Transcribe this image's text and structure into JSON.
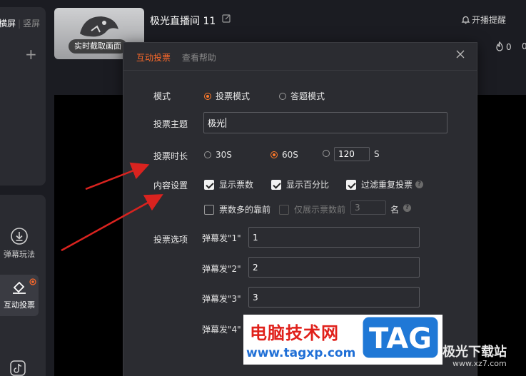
{
  "sidebar": {
    "tabs": {
      "landscape": "横屏",
      "portrait": "竖屏"
    },
    "add_icon": "plus-icon",
    "tools": [
      {
        "label": "弹幕玩法",
        "icon": "download-icon"
      },
      {
        "label": "互动投票",
        "icon": "vote-icon"
      }
    ]
  },
  "header": {
    "capture_button": "实时截取画面",
    "room_title": "极光直播间 11",
    "remind": "开播提醒",
    "hot_count": "0",
    "hot_count_2": "0"
  },
  "dialog": {
    "tabs": [
      "互动投票",
      "查看帮助"
    ],
    "mode": {
      "label": "模式",
      "options": [
        {
          "label": "投票模式",
          "selected": true
        },
        {
          "label": "答题模式",
          "selected": false
        }
      ]
    },
    "topic": {
      "label": "投票主题",
      "value": "极光"
    },
    "duration": {
      "label": "投票时长",
      "options": [
        {
          "label": "30S",
          "selected": false
        },
        {
          "label": "60S",
          "selected": true
        },
        {
          "label": "",
          "selected": false
        }
      ],
      "custom_value": "120",
      "unit": "S"
    },
    "content": {
      "label": "内容设置",
      "checks": [
        {
          "label": "显示票数",
          "checked": true
        },
        {
          "label": "显示百分比",
          "checked": true
        },
        {
          "label": "过滤重复投票",
          "checked": true
        },
        {
          "label": "票数多的靠前",
          "checked": false
        },
        {
          "label": "仅展示票数前",
          "checked": false
        }
      ],
      "top_n_value": "3",
      "top_n_unit": "名",
      "help_glyph": "?"
    },
    "options": {
      "label": "投票选项",
      "items": [
        {
          "key": "弹幕发\"1\"",
          "value": "1"
        },
        {
          "key": "弹幕发\"2\"",
          "value": "2"
        },
        {
          "key": "弹幕发\"3\"",
          "value": "3"
        },
        {
          "key": "弹幕发\"4\"",
          "value": ""
        }
      ]
    }
  },
  "watermark": {
    "cn_text": "电脑技术网",
    "url": "www.tagxp.com",
    "tag_text": "TAG",
    "site": "极光下载站",
    "site_url": "www.xz7.com"
  },
  "colors": {
    "accent": "#ff6a2a",
    "arrow": "#d9231f",
    "tag_blue": "#1f78d6"
  }
}
